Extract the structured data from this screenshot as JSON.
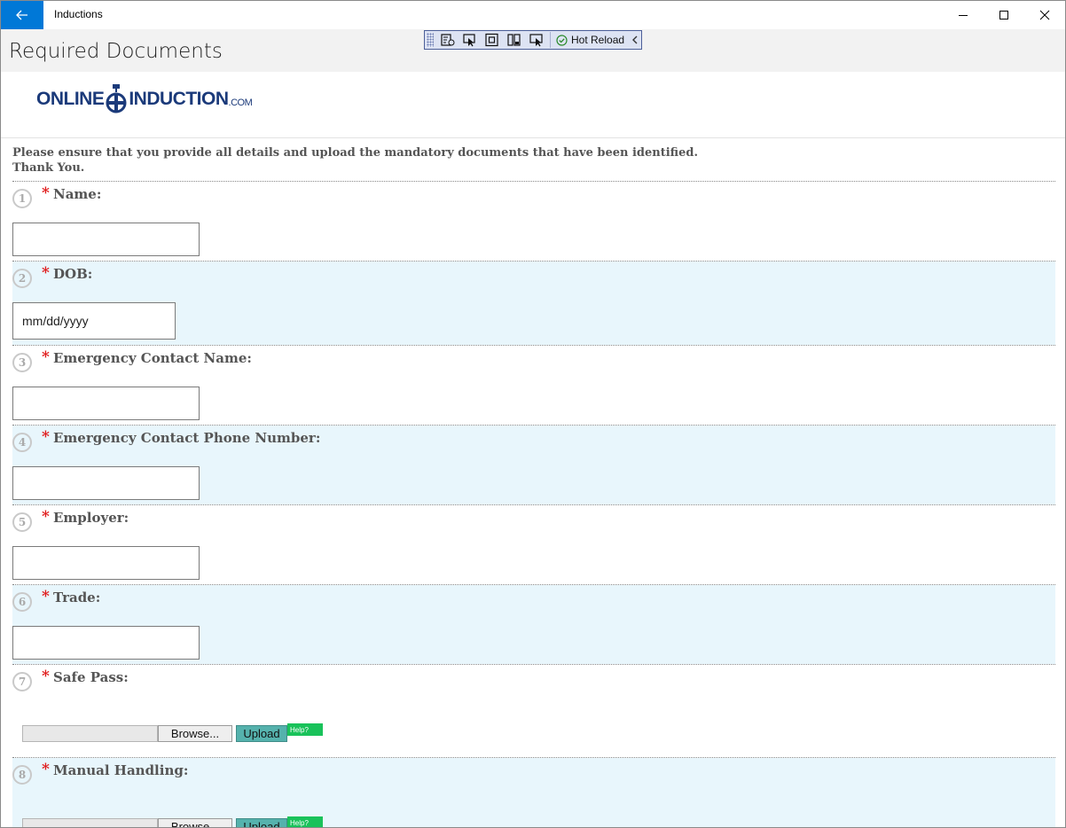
{
  "window": {
    "app_title": "Inductions",
    "back_icon": "back-arrow-icon",
    "minimize_icon": "minimize-icon",
    "maximize_icon": "maximize-icon",
    "close_icon": "close-icon"
  },
  "page": {
    "title": "Required Documents"
  },
  "debug_toolbar": {
    "hot_reload_label": "Hot Reload"
  },
  "logo": {
    "part1": "ONLINE",
    "part2": "INDUCTION",
    "suffix": ".COM"
  },
  "intro": {
    "line1": "Please ensure that you provide all details and upload the mandatory documents that have been identified.",
    "line2": "Thank You."
  },
  "required_marker": "*",
  "fields": [
    {
      "num": "1",
      "label": "Name:"
    },
    {
      "num": "2",
      "label": "DOB:",
      "placeholder": "mm/dd/yyyy"
    },
    {
      "num": "3",
      "label": "Emergency Contact Name:"
    },
    {
      "num": "4",
      "label": "Emergency Contact Phone Number:"
    },
    {
      "num": "5",
      "label": "Employer:"
    },
    {
      "num": "6",
      "label": "Trade:"
    },
    {
      "num": "7",
      "label": "Safe Pass:"
    },
    {
      "num": "8",
      "label": "Manual Handling:"
    }
  ],
  "upload": {
    "browse_label": "Browse...",
    "upload_label": "Upload",
    "help_label": "Help?"
  },
  "colors": {
    "accent": "#0078d7",
    "alt_row": "#e8f6fc",
    "required": "#e01b1b",
    "upload_btn": "#55b2ad",
    "help_badge": "#19c25a",
    "logo": "#1b3a7a"
  }
}
